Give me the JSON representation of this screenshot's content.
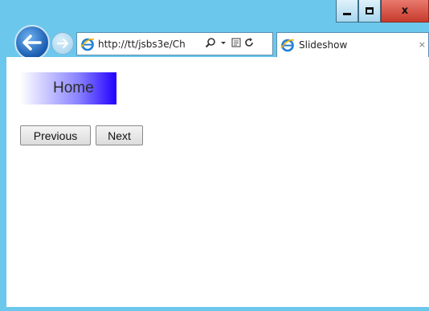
{
  "window": {
    "close_glyph": "x"
  },
  "address_bar": {
    "url": "http://tt/jsbs3e/Ch"
  },
  "tab": {
    "title": "Slideshow",
    "close_glyph": "×"
  },
  "page": {
    "slide_title": "Home",
    "previous_label": "Previous",
    "next_label": "Next"
  },
  "colors": {
    "chrome": "#6cc7ec",
    "close_button": "#c63b2c",
    "banner_gradient_end": "#2200ff"
  },
  "icons": {
    "back": "back-arrow-icon",
    "forward": "forward-arrow-icon",
    "browser": "internet-explorer-icon",
    "search": "search-icon",
    "dropdown": "chevron-down-icon",
    "compat": "compatibility-view-icon",
    "refresh": "refresh-icon"
  }
}
